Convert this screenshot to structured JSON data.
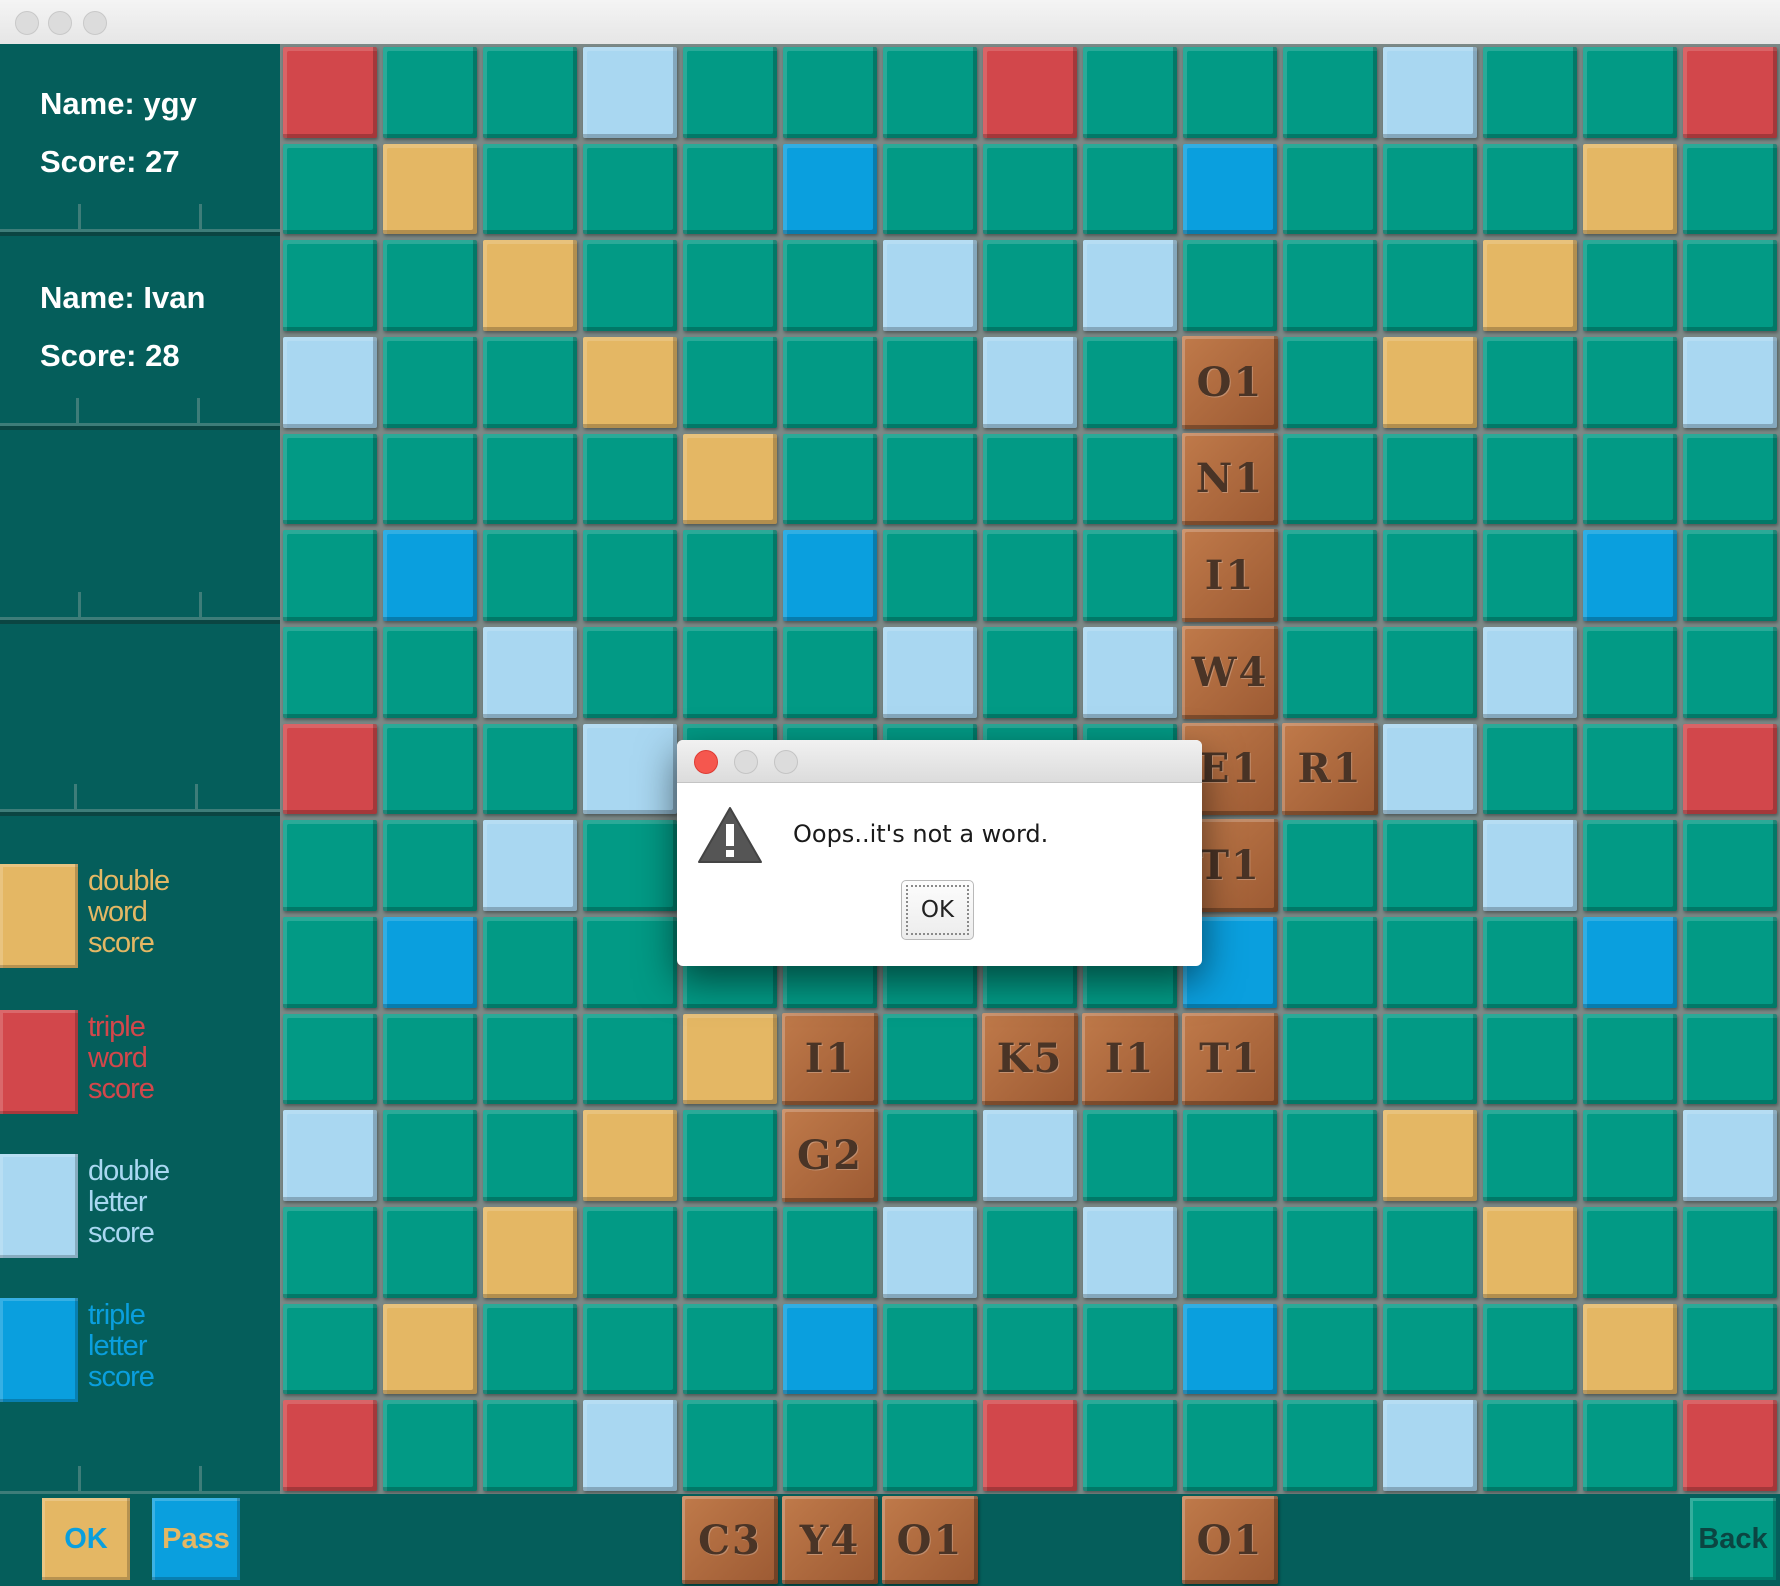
{
  "players": [
    {
      "name": "Name: ygy",
      "score": "Score: 27"
    },
    {
      "name": "Name: Ivan",
      "score": "Score: 28"
    }
  ],
  "legend": [
    {
      "key": "dw",
      "text": "double\nword\nscore",
      "color": "#e4b764"
    },
    {
      "key": "tw",
      "text": "triple\nword\nscore",
      "color": "#d2474b"
    },
    {
      "key": "dl",
      "text": "double\nletter\nscore",
      "color": "#a9d7f1"
    },
    {
      "key": "tl",
      "text": "triple\nletter\nscore",
      "color": "#0a9fde"
    }
  ],
  "colors": {
    "n": "#029a85",
    "dw": "#e4b764",
    "tw": "#d2474b",
    "dl": "#a9d7f1",
    "tl": "#0a9fde",
    "panel": "#055e5b"
  },
  "board": {
    "rows": [
      "TnnLnnnTnnnLnnT",
      "nDnnnlnnnlnnnDn",
      "nnDnnnLnLnnnDnn",
      "LnnDnnnLnnnDnnL",
      "nnnnDnnnnnnnnnn",
      "nlnnnlnnnnnnnln",
      "nnLnnnLnLnnnLnn",
      "TnnLnnnnnnnLnnT",
      "nnLnnnnnnnnnLnn",
      "nlnnnnnnnlnnnln",
      "nnnnDnnnnnnnnnn",
      "LnnDnnnLnnnDnnL",
      "nnDnnnLnLnnnDnn",
      "nDnnnlnnnlnnnDn",
      "TnnLnnnTnnnLnnT"
    ],
    "tiles": [
      {
        "row": 3,
        "col": 9,
        "text": "O1"
      },
      {
        "row": 4,
        "col": 9,
        "text": "N1"
      },
      {
        "row": 5,
        "col": 9,
        "text": "I1"
      },
      {
        "row": 6,
        "col": 9,
        "text": "W4"
      },
      {
        "row": 7,
        "col": 9,
        "text": "E1"
      },
      {
        "row": 7,
        "col": 10,
        "text": "R1"
      },
      {
        "row": 8,
        "col": 9,
        "text": "T1"
      },
      {
        "row": 10,
        "col": 5,
        "text": "I1"
      },
      {
        "row": 10,
        "col": 7,
        "text": "K5"
      },
      {
        "row": 10,
        "col": 8,
        "text": "I1"
      },
      {
        "row": 10,
        "col": 9,
        "text": "T1"
      },
      {
        "row": 11,
        "col": 5,
        "text": "G2"
      }
    ]
  },
  "rack": [
    "C3",
    "Y4",
    "O1",
    "",
    "",
    "O1"
  ],
  "buttons": {
    "ok": "OK",
    "pass": "Pass",
    "back": "Back"
  },
  "dialog": {
    "message": "Oops..it's not a word.",
    "ok_label": "OK"
  }
}
